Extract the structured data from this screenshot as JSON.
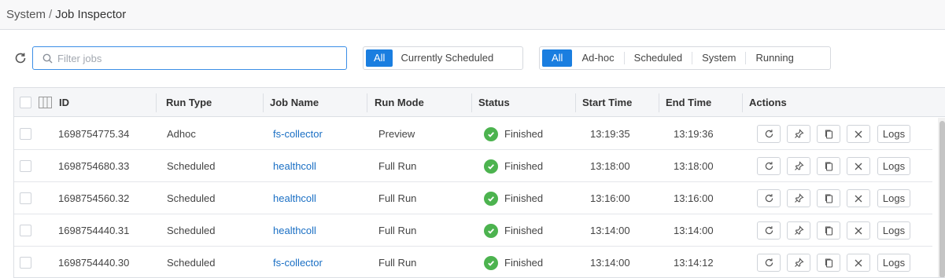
{
  "breadcrumb": {
    "root": "System",
    "separator": "/",
    "current": "Job Inspector"
  },
  "search": {
    "placeholder": "Filter jobs",
    "value": ""
  },
  "filter_schedule": {
    "options": [
      "All",
      "Currently Scheduled"
    ],
    "selected": "All"
  },
  "filter_type": {
    "options": [
      "All",
      "Ad-hoc",
      "Scheduled",
      "System",
      "Running"
    ],
    "selected": "All"
  },
  "table": {
    "columns": [
      "ID",
      "Run Type",
      "Job Name",
      "Run Mode",
      "Status",
      "Start Time",
      "End Time",
      "Actions"
    ],
    "rows": [
      {
        "id": "1698754775.34",
        "run_type": "Adhoc",
        "job_name": "fs-collector",
        "run_mode": "Preview",
        "status": "Finished",
        "start": "13:19:35",
        "end": "13:19:36"
      },
      {
        "id": "1698754680.33",
        "run_type": "Scheduled",
        "job_name": "healthcoll",
        "run_mode": "Full Run",
        "status": "Finished",
        "start": "13:18:00",
        "end": "13:18:00"
      },
      {
        "id": "1698754560.32",
        "run_type": "Scheduled",
        "job_name": "healthcoll",
        "run_mode": "Full Run",
        "status": "Finished",
        "start": "13:16:00",
        "end": "13:16:00"
      },
      {
        "id": "1698754440.31",
        "run_type": "Scheduled",
        "job_name": "healthcoll",
        "run_mode": "Full Run",
        "status": "Finished",
        "start": "13:14:00",
        "end": "13:14:00"
      },
      {
        "id": "1698754440.30",
        "run_type": "Scheduled",
        "job_name": "fs-collector",
        "run_mode": "Full Run",
        "status": "Finished",
        "start": "13:14:00",
        "end": "13:14:12"
      }
    ],
    "action_logs_label": "Logs",
    "action_icons": [
      "rerun-icon",
      "pin-icon",
      "copy-icon",
      "cancel-icon"
    ]
  },
  "colors": {
    "accent": "#1a7ee0",
    "link": "#1a6fc4",
    "success": "#4cb34f",
    "border": "#dcdfe4"
  }
}
